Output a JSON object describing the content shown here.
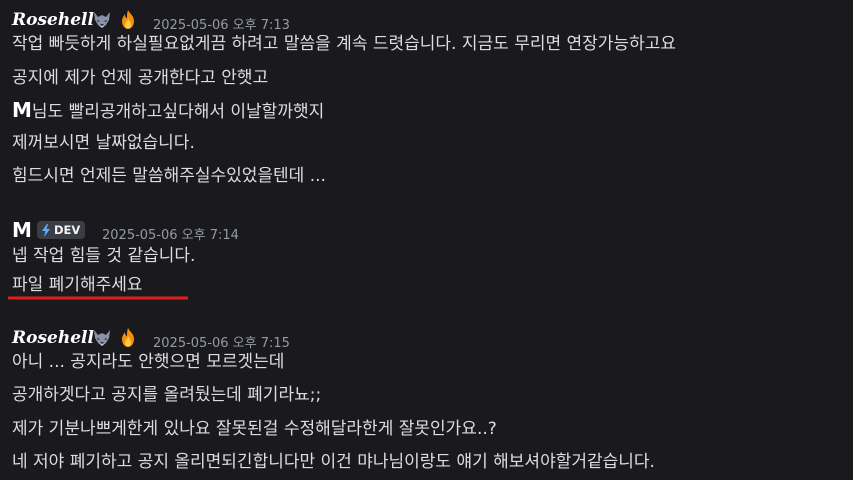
{
  "messages": [
    {
      "author": "Rosehell",
      "timestamp": "2025-05-06 오후 7:13",
      "icons": [
        "wolf-icon",
        "fire-icon"
      ],
      "lines": [
        "작업 빠듯하게 하실필요없게끔 하려고 말씀을 계속 드렷습니다. 지금도 무리면 연장가능하고요",
        "공지에 제가 언제 공개한다고 안햇고",
        "님도 빨리공개하고싶다해서 이날할까햇지",
        "제꺼보시면 날짜없습니다.",
        "힘드시면 언제든 말씀해주실수있었을텐데 ..."
      ],
      "inline_mention": "M"
    },
    {
      "author": "M",
      "badge": "DEV",
      "timestamp": "2025-05-06 오후 7:14",
      "lines": [
        "넵 작업 힘들 것 같습니다.",
        "파일 폐기해주세요"
      ]
    },
    {
      "author": "Rosehell",
      "timestamp": "2025-05-06 오후 7:15",
      "icons": [
        "wolf-icon",
        "fire-icon"
      ],
      "lines": [
        "아니 ... 공지라도 안햇으면 모르겟는데",
        "공개하겟다고 공지를 올려뒀는데 폐기라뇨;;",
        "제가 기분나쁘게한게 있나요 잘못된걸 수정해달라한게 잘못인가요..?",
        "네 저야 폐기하고 공지 올리면되긴합니다만 이건 먀나님이랑도 얘기 해보셔야할거같습니다."
      ]
    }
  ],
  "colors": {
    "background": "#1a1a1e",
    "text": "#dbdee1",
    "timestamp": "#949ba4",
    "underline": "#e01e1e",
    "badge_bg": "#3b3d44",
    "bolt": "#5ab0ff"
  }
}
